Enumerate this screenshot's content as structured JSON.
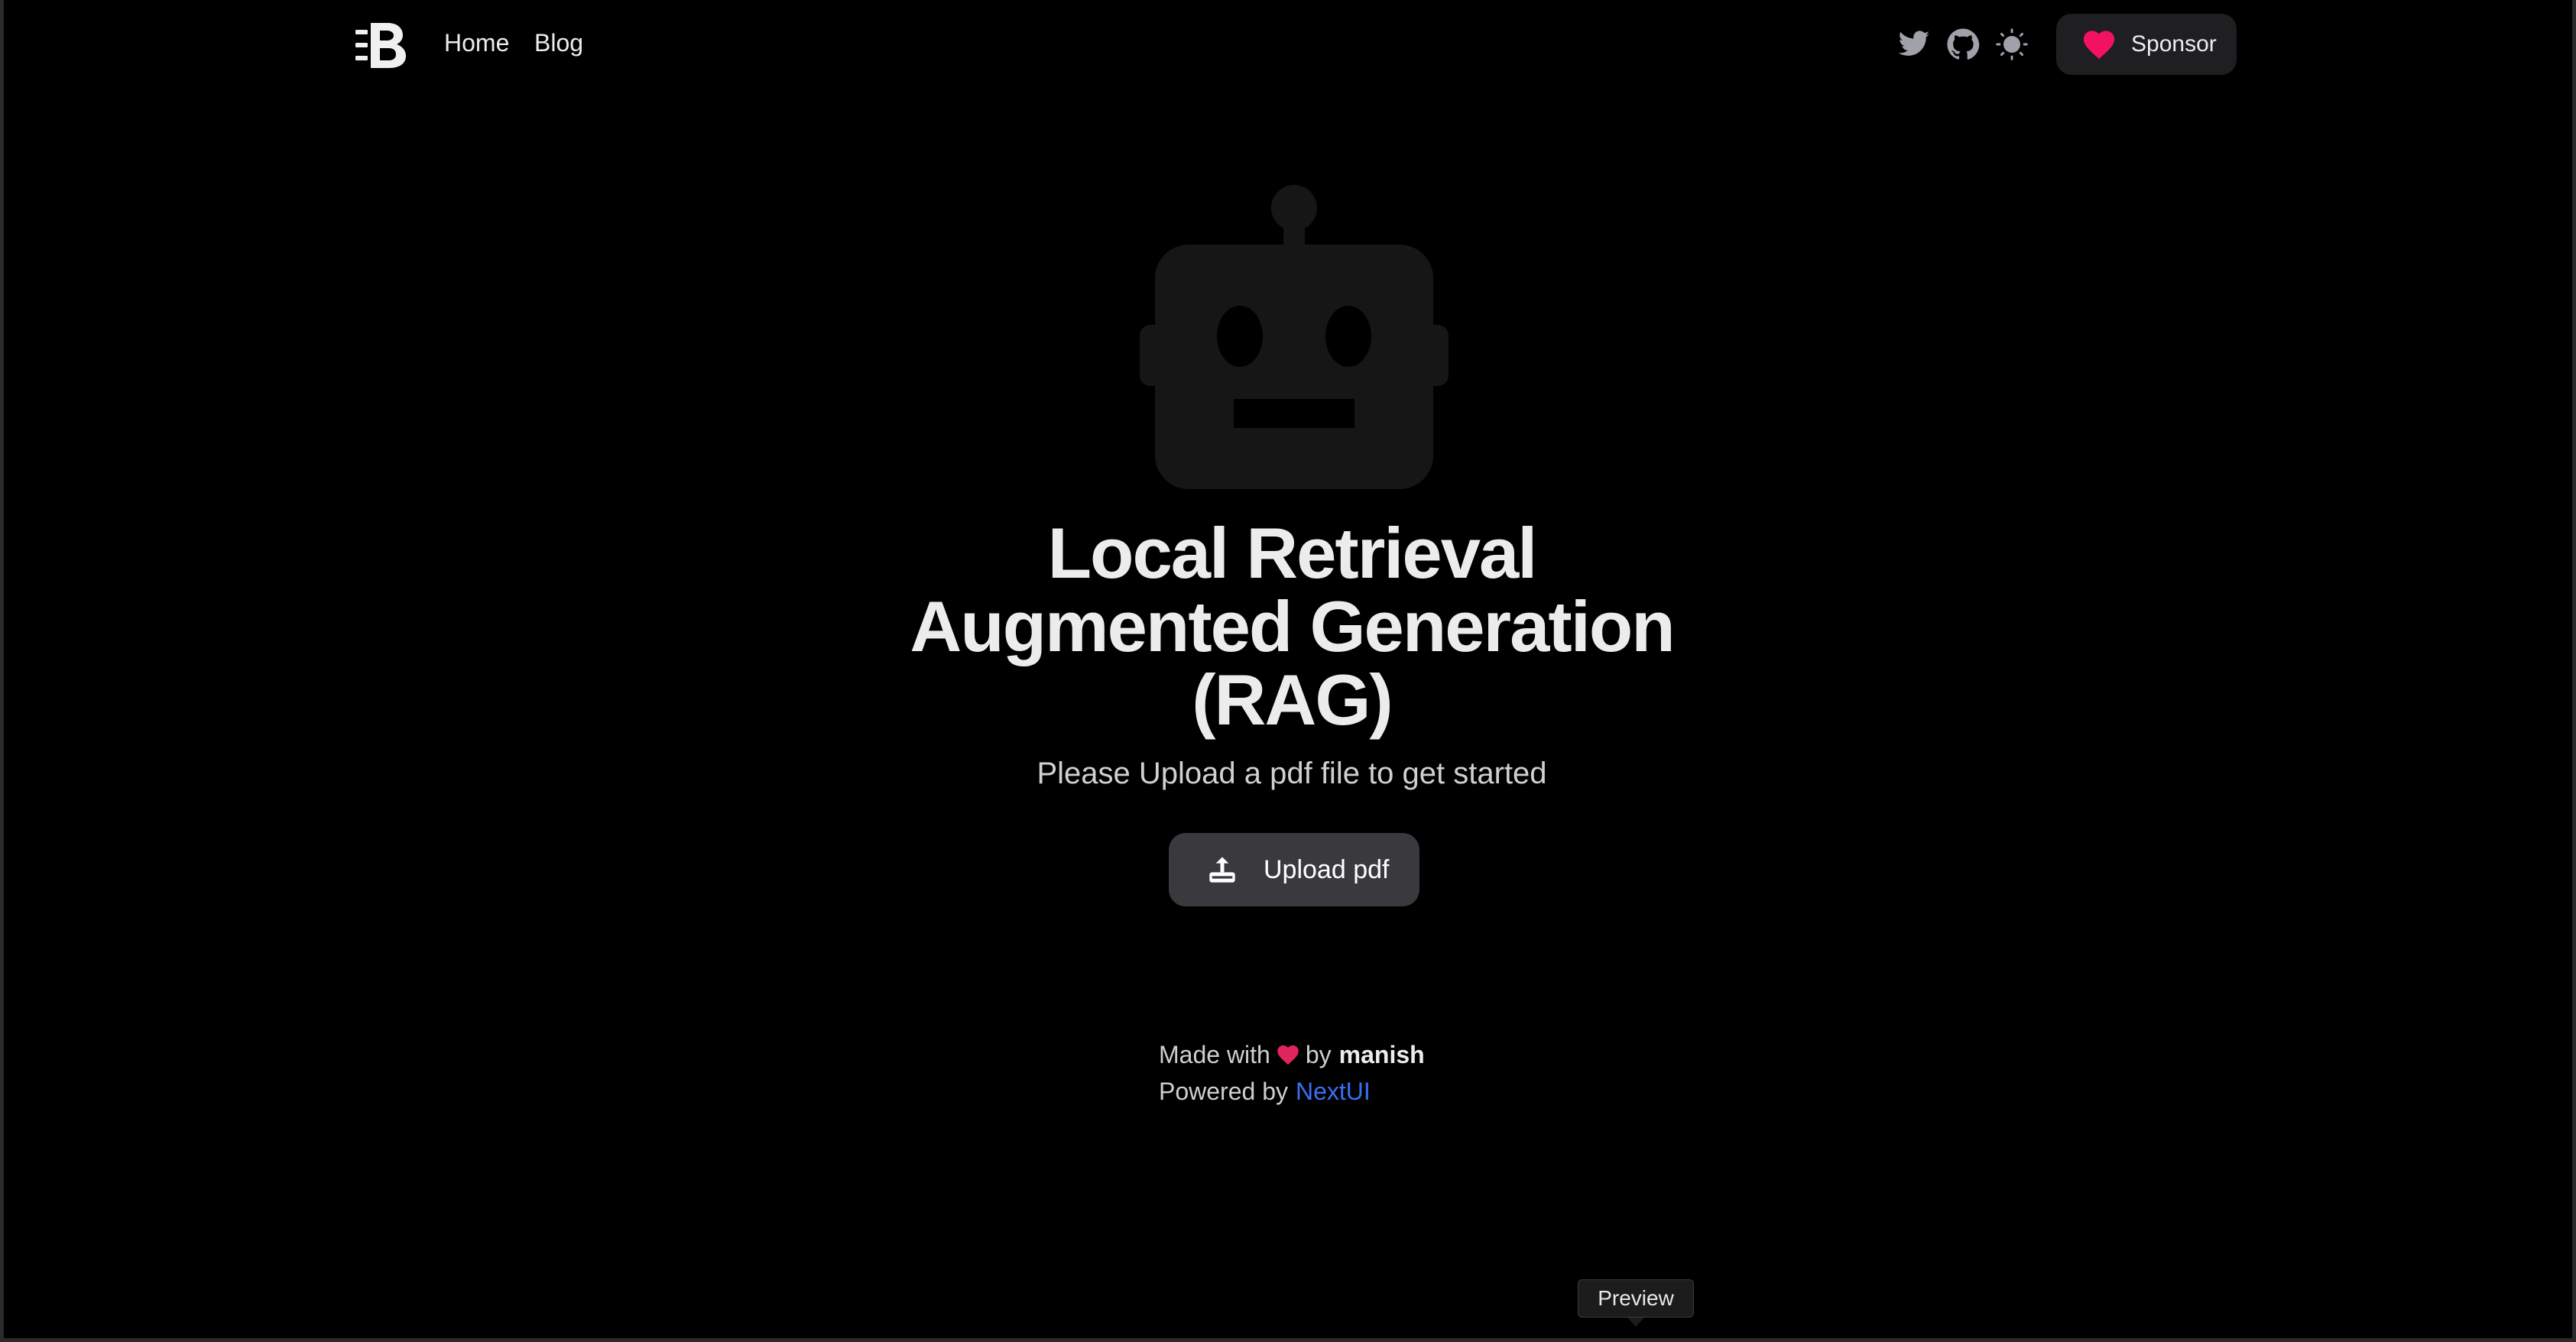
{
  "nav": {
    "links": [
      {
        "label": "Home"
      },
      {
        "label": "Blog"
      }
    ],
    "sponsor_label": "Sponsor",
    "icons": [
      "logo-icon",
      "twitter-icon",
      "github-icon",
      "sun-icon",
      "heart-icon"
    ]
  },
  "hero": {
    "title_lines": [
      "Local Retrieval",
      "Augmented Generation",
      "(RAG)"
    ],
    "subtitle": "Please Upload a pdf file to get started",
    "upload_label": "Upload pdf",
    "icon": "robot-icon"
  },
  "footer": {
    "made_with": "Made with",
    "by": "by",
    "author": "manish",
    "powered_by": "Powered by",
    "powered_link": "NextUI"
  },
  "tooltip": {
    "label": "Preview"
  },
  "colors": {
    "background": "#000000",
    "sponsor_heart": "#f31260",
    "link": "#3b6ef5",
    "button": "#3a3a3e"
  }
}
